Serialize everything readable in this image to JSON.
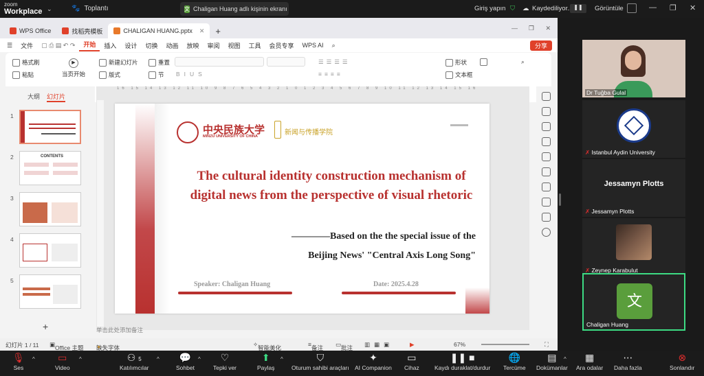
{
  "zoom": {
    "brand_small": "zoom",
    "brand": "Workplace",
    "meeting_label": "Toplantı",
    "share_status": "Chaligan Huang adlı kişinin ekranı",
    "signin": "Giriş yapın",
    "saving": "Kaydediliyor...",
    "view": "Görüntüle"
  },
  "wps": {
    "tabs": [
      {
        "label": "WPS Office"
      },
      {
        "label": "找稻壳模板"
      },
      {
        "label": "CHALIGAN HUANG.pptx"
      }
    ],
    "file_menu": "文件",
    "menus": [
      "开始",
      "插入",
      "设计",
      "切换",
      "动画",
      "放映",
      "审阅",
      "视图",
      "工具",
      "会员专享",
      "WPS AI"
    ],
    "share_btn": "分享",
    "ribbon": {
      "format_painter": "格式刷",
      "paste": "粘贴",
      "play_from": "当页开始",
      "new_slide": "新建幻灯片",
      "layout": "版式",
      "reset": "重置",
      "section": "节",
      "shape": "形状",
      "textbox": "文本框"
    },
    "left_tabs": [
      "大纲",
      "幻灯片"
    ],
    "slide_numbers": [
      "1",
      "2",
      "3",
      "4",
      "5"
    ],
    "thumb2_title": "CONTENTS",
    "notes_placeholder": "单击此处添加备注",
    "status": {
      "slide_count": "幻灯片 1 / 11",
      "theme": "Office 主题",
      "missing_font": "缺失字体",
      "smart": "智能美化",
      "notes": "备注",
      "comments": "批注",
      "zoom": "67%"
    }
  },
  "slide": {
    "university_cn": "中央民族大学",
    "university_en": "MINZU UNIVERSITY OF CHINA",
    "college_cn": "新闻与传播学院",
    "title_line1": "The cultural identity construction mechanism of",
    "title_line2": "digital news from the perspective of visual rhetoric",
    "subtitle_line1": "————Based on the the special issue of the",
    "subtitle_line2": "Beijing News' \"Central Axis Long Song\"",
    "speaker": "Speaker:  Chaligan Huang",
    "date": "Date:  2025.4.28",
    "accent": "#b8312f"
  },
  "participants": [
    {
      "name": "Dr Tuğba Gulal",
      "type": "video"
    },
    {
      "name": "Istanbul Aydin University",
      "type": "logo"
    },
    {
      "name": "Jessamyn Plotts",
      "type": "name"
    },
    {
      "name": "Zeynep Karabulut",
      "type": "photo"
    },
    {
      "name": "Chaligan Huang",
      "type": "avatar",
      "avatar_char": "文",
      "avatar_color": "#5a9e3c"
    }
  ],
  "toolbar": {
    "mute": "Ses",
    "video": "Video",
    "participants": "Katılımcılar",
    "participants_count": "5",
    "chat": "Sohbet",
    "react": "Tepki ver",
    "share": "Paylaş",
    "host_tools": "Oturum sahibi araçları",
    "ai": "AI Companion",
    "record": "Kaydı duraklat/durdur",
    "translate": "Tercüme",
    "docs": "Dokümanlar",
    "breakout": "Ara odalar",
    "more": "Daha fazla",
    "end": "Sonlandır",
    "device": "Cihaz"
  }
}
